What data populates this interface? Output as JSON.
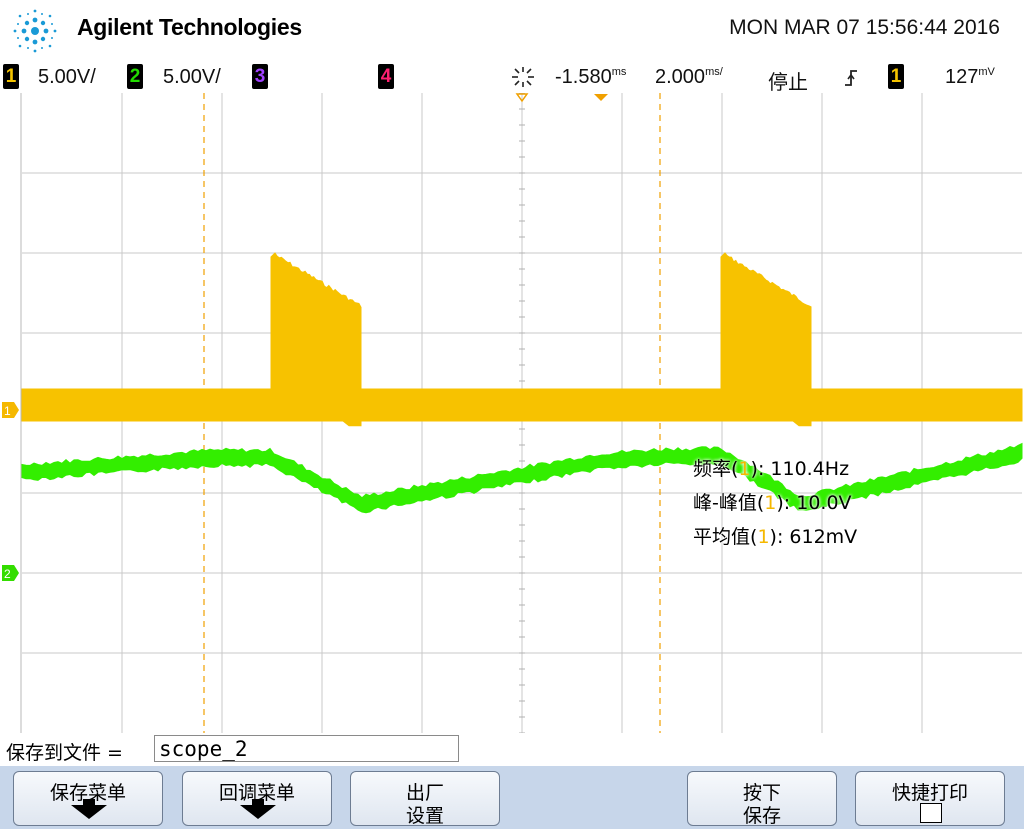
{
  "header": {
    "brand": "Agilent Technologies",
    "datetime": "MON MAR 07 15:56:44 2016",
    "logo_icon": "agilent-spark-icon"
  },
  "status": {
    "ch1": {
      "num": "1",
      "scale": "5.00V/",
      "color": "#f5c400"
    },
    "ch2": {
      "num": "2",
      "scale": "5.00V/",
      "color": "#22dd00"
    },
    "ch3": {
      "num": "3",
      "color": "#a040ff"
    },
    "ch4": {
      "num": "4",
      "color": "#ff2070"
    },
    "time_delay": "-1.580",
    "delay_unit": "ms",
    "time_scale": "2.000",
    "scale_unit": "ms/",
    "run_state": "停止",
    "trigger_source": "1",
    "trigger_level": "127",
    "trigger_unit": "mV"
  },
  "markers": {
    "ch1": "1",
    "ch2": "2"
  },
  "measurements": {
    "freq_label": "频率",
    "freq_value": "110.4Hz",
    "pp_label": "峰-峰值",
    "pp_value": "10.0V",
    "avg_label": "平均值",
    "avg_value": "612mV",
    "channel": "1"
  },
  "save": {
    "label": "保存到文件 =",
    "filename": "scope_2"
  },
  "softkeys": {
    "save_menu": "保存菜单",
    "recall_menu": "回调菜单",
    "factory_l1": "出厂",
    "factory_l2": "设置",
    "press_l1": "按下",
    "press_l2": "保存",
    "quick_print": "快捷打印"
  },
  "chart_data": {
    "type": "line",
    "volts_per_div": 5.0,
    "time_per_div_ms": 2.0,
    "time_delay_ms": -1.58,
    "x_range_ms": [
      -11.58,
      8.42
    ],
    "series": [
      {
        "name": "",
        "channel": "1",
        "offset_div": 0.0,
        "y_range_v": [
          -0.5,
          1.5
        ],
        "burst_high_v": [
          10.0,
          6.8
        ],
        "burst_low_v": -0.8,
        "bursts": [
          {
            "start_ms": -6.6,
            "end_ms": -4.8
          },
          {
            "start_ms": 2.4,
            "end_ms": 4.2
          }
        ]
      },
      {
        "name": "",
        "channel": "2",
        "offset_div": -2.0,
        "x_ms": [
          -11.58,
          -9.5,
          -7.8,
          -6.6,
          -4.8,
          0.0,
          1.4,
          2.4,
          3.0,
          4.0,
          8.42
        ],
        "y_v": [
          6.3,
          6.8,
          7.2,
          7.2,
          4.3,
          7.0,
          7.3,
          7.3,
          6.3,
          4.3,
          7.5
        ],
        "noise_v": 0.6
      }
    ]
  }
}
